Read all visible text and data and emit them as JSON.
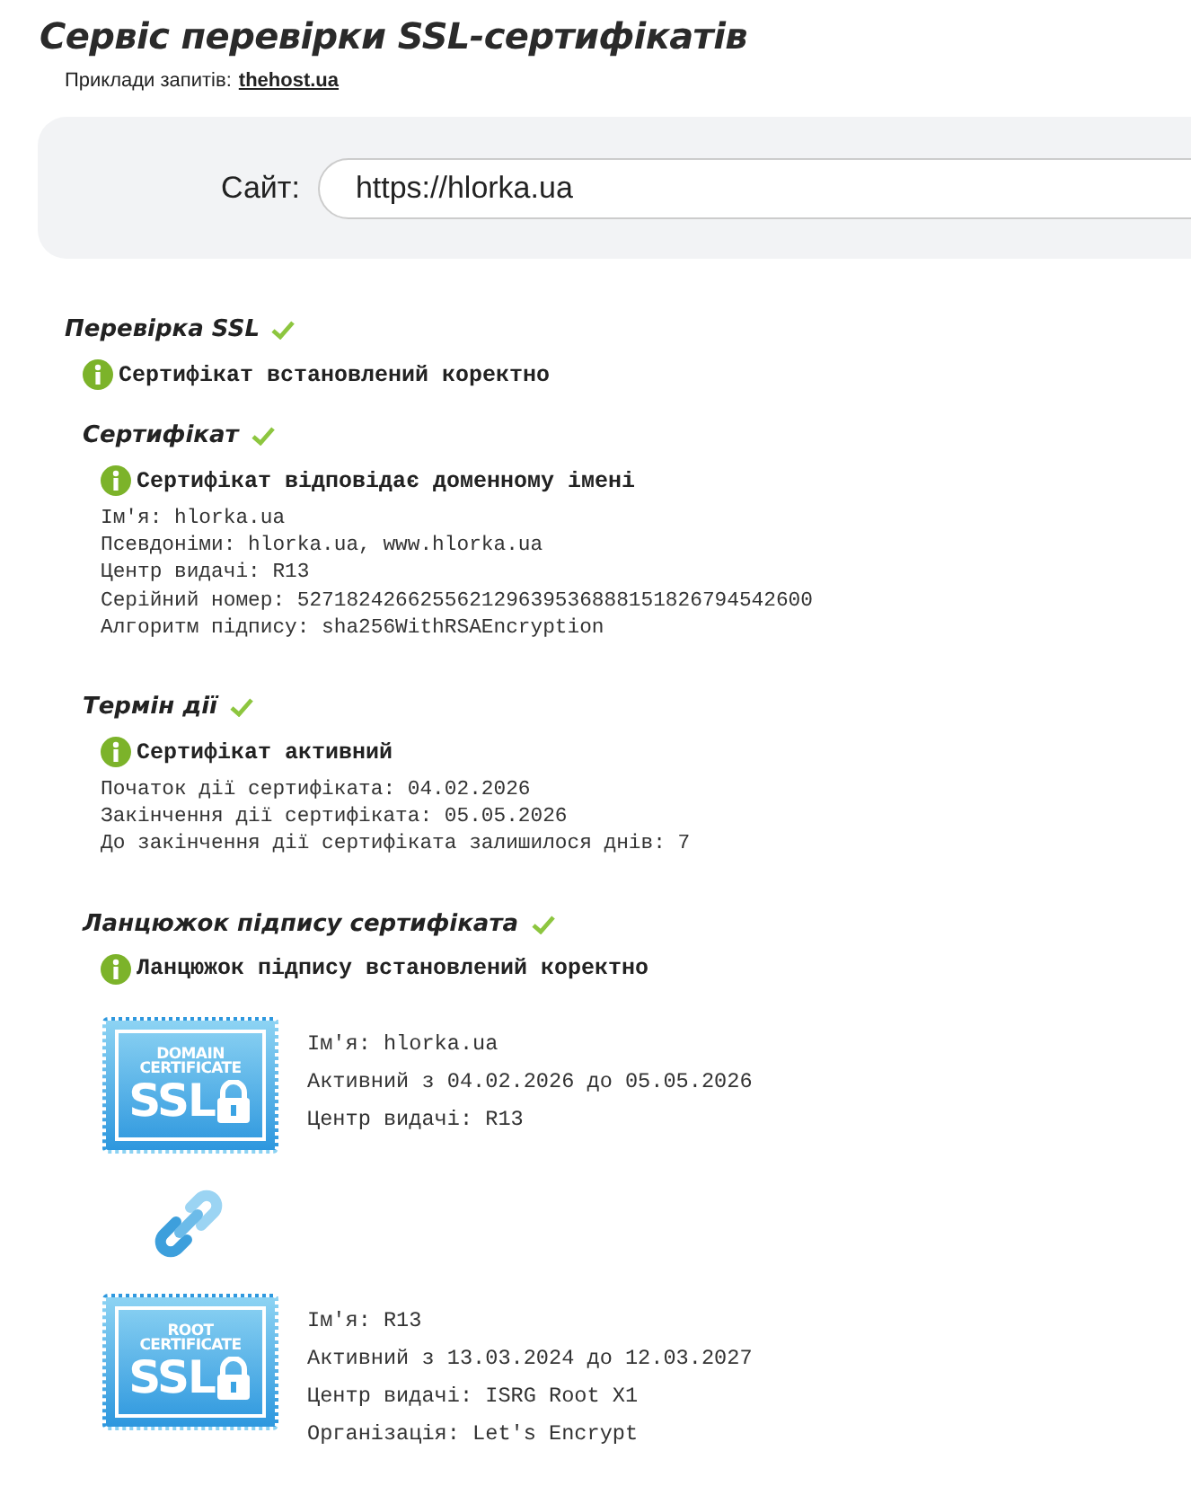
{
  "title": "Сервіс перевірки SSL-сертифікатів",
  "examples": {
    "label": "Приклади запитів:",
    "link": "thehost.ua"
  },
  "search": {
    "label": "Сайт:",
    "value": "https://hlorka.ua"
  },
  "sections": [
    {
      "heading": "Перевірка SSL",
      "ok": true,
      "kind": "section",
      "status": "Сертифікат встановлений коректно"
    },
    {
      "heading": "Сертифікат",
      "ok": true,
      "kind": "subsection",
      "status": "Сертифікат відповідає доменному імені",
      "lines": [
        "Ім'я: hlorka.ua",
        "Псевдоніми: hlorka.ua, www.hlorka.ua",
        "Центр видачі: R13",
        "Серійний номер: 527182426625562129639536888151826794542600",
        "Алгоритм підпису: sha256WithRSAEncryption"
      ]
    },
    {
      "heading": "Термін дії",
      "ok": true,
      "kind": "subsection",
      "status": "Сертифікат активний",
      "lines": [
        "Початок дії сертифіката: 04.02.2026",
        "Закінчення дії сертифіката: 05.05.2026",
        "До закінчення дії сертифіката залишилося днів: 7"
      ]
    },
    {
      "heading": "Ланцюжок підпису сертифіката",
      "ok": true,
      "kind": "subsection",
      "status": "Ланцюжок підпису встановлений коректно"
    }
  ],
  "chain": [
    {
      "badge": [
        "DOMAIN",
        "CERTIFICATE",
        "SSL"
      ],
      "lines": [
        "Ім'я: hlorka.ua",
        "Активний з 04.02.2026 до 05.05.2026",
        "Центр видачі: R13"
      ]
    },
    {
      "badge": [
        "ROOT",
        "CERTIFICATE",
        "SSL"
      ],
      "lines": [
        "Ім'я: R13",
        "Активний з 13.03.2024 до 12.03.2027",
        "Центр видачі: ISRG Root X1",
        "Організація: Let's Encrypt"
      ]
    }
  ]
}
